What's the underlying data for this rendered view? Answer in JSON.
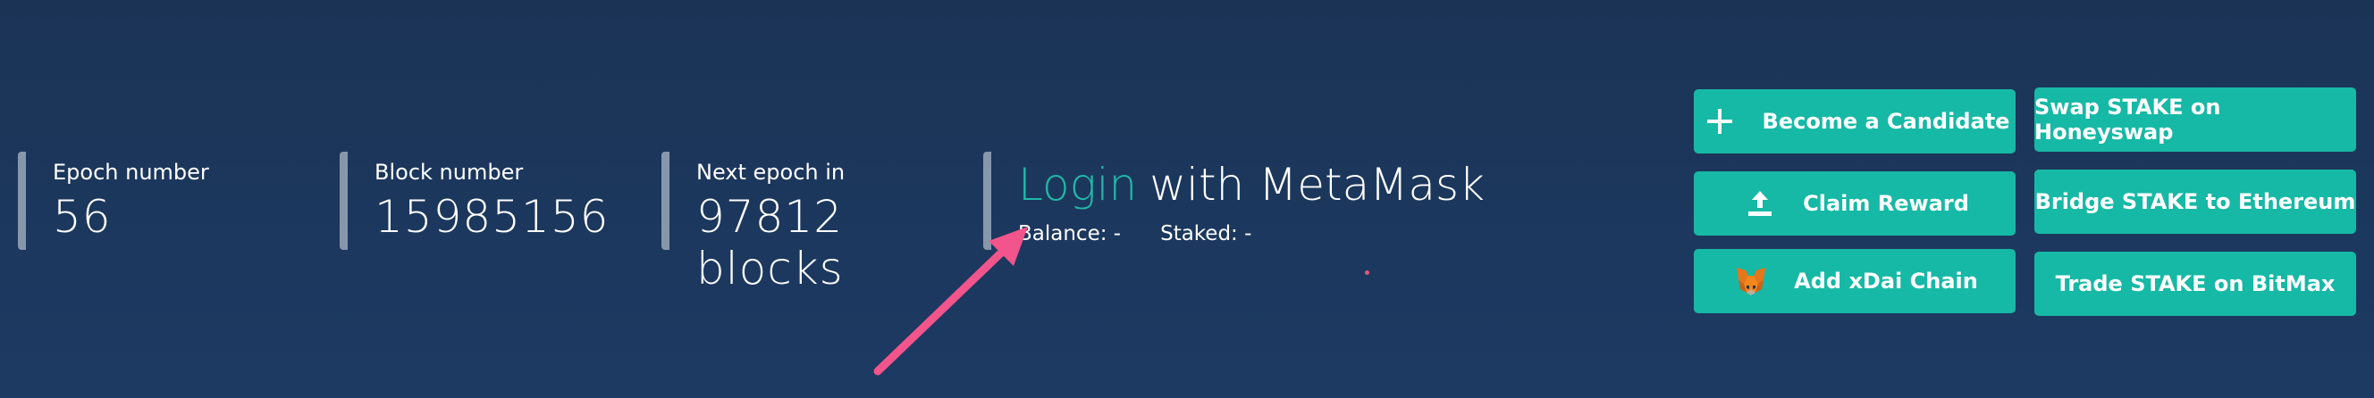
{
  "stats": {
    "epoch": {
      "label": "Epoch number",
      "value": "56"
    },
    "block": {
      "label": "Block number",
      "value": "15985156"
    },
    "next_epoch": {
      "label": "Next epoch in",
      "value": "97812 blocks"
    }
  },
  "login": {
    "link_text": "Login",
    "rest_text": "with MetaMask",
    "balance": "Balance: -",
    "staked": "Staked: -"
  },
  "buttons": {
    "become_candidate": "Become a Candidate",
    "claim_reward": "Claim Reward",
    "add_xdai": "Add xDai Chain",
    "swap_honeyswap": "Swap STAKE on Honeyswap",
    "bridge_ethereum": "Bridge STAKE to Ethereum",
    "trade_bitmax": "Trade STAKE on BitMax"
  },
  "icons": {
    "become_candidate": "plus-icon",
    "claim_reward": "upload-icon",
    "add_xdai": "metamask-fox-icon"
  },
  "colors": {
    "background": "#1b3456",
    "accent": "#16b9a5",
    "link": "#22b7a8",
    "divider": "#8797ab",
    "annotation_arrow": "#f2548c"
  }
}
